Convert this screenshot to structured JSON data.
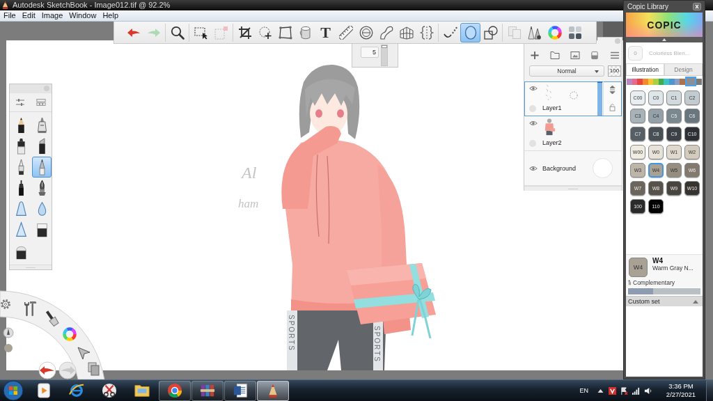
{
  "window": {
    "title": "Autodesk SketchBook - Image012.tif @ 92.2%"
  },
  "menu": [
    "File",
    "Edit",
    "Image",
    "Window",
    "Help"
  ],
  "toolbar": {
    "groups": [
      {
        "tools": [
          {
            "kind": "undo",
            "selected": false,
            "disabled": false
          },
          {
            "kind": "redo",
            "selected": false,
            "disabled": true
          }
        ]
      },
      {
        "tools": [
          {
            "kind": "zoom",
            "selected": false,
            "disabled": false
          }
        ]
      },
      {
        "tools": [
          {
            "kind": "select",
            "selected": false,
            "disabled": false
          },
          {
            "kind": "select-stamp",
            "selected": false,
            "disabled": true
          }
        ]
      },
      {
        "tools": [
          {
            "kind": "crop",
            "selected": false,
            "disabled": false
          },
          {
            "kind": "transform",
            "selected": false,
            "disabled": false
          },
          {
            "kind": "distort",
            "selected": false,
            "disabled": false
          },
          {
            "kind": "fill",
            "selected": false,
            "disabled": false
          },
          {
            "kind": "text",
            "label": "T",
            "selected": false,
            "disabled": false
          },
          {
            "kind": "ruler",
            "selected": false,
            "disabled": false
          },
          {
            "kind": "ellipse-guide",
            "selected": false,
            "disabled": false
          },
          {
            "kind": "french-curve",
            "selected": false,
            "disabled": false
          },
          {
            "kind": "perspective",
            "selected": false,
            "disabled": false
          },
          {
            "kind": "symmetry",
            "selected": false,
            "disabled": false
          }
        ]
      },
      {
        "tools": [
          {
            "kind": "steady-stroke",
            "selected": false,
            "disabled": false
          },
          {
            "kind": "ellipse",
            "selected": true,
            "disabled": false
          },
          {
            "kind": "shapes",
            "selected": false,
            "disabled": false
          }
        ]
      },
      {
        "tools": [
          {
            "kind": "copy",
            "selected": false,
            "disabled": true
          },
          {
            "kind": "brushes",
            "selected": false,
            "disabled": false
          },
          {
            "kind": "color-wheel",
            "selected": false,
            "disabled": false
          },
          {
            "kind": "swatches",
            "selected": false,
            "disabled": false
          }
        ]
      }
    ]
  },
  "brush_size": {
    "value": "5",
    "level": 1
  },
  "canvas": {
    "sketch_notes": [
      "Al",
      "ham"
    ],
    "pants_prints": [
      "SPORTS",
      "SPORTS"
    ]
  },
  "layers": {
    "blend_mode": "Normal",
    "opacity": "100",
    "items": [
      {
        "name": "Layer1",
        "kind": "sketch",
        "visible": true,
        "selected": true
      },
      {
        "name": "Layer2",
        "kind": "figure",
        "visible": true,
        "selected": false
      },
      {
        "name": "Background",
        "kind": "background",
        "visible": true,
        "selected": false
      }
    ]
  },
  "brush_palette": {
    "brushes": [
      {
        "kind": "pencil",
        "selected": false
      },
      {
        "kind": "airbrush",
        "selected": false
      },
      {
        "kind": "marker",
        "selected": false
      },
      {
        "kind": "chisel",
        "selected": false
      },
      {
        "kind": "pen",
        "selected": false
      },
      {
        "kind": "ballpoint",
        "selected": true
      },
      {
        "kind": "fineliner",
        "selected": false
      },
      {
        "kind": "nib",
        "selected": false
      },
      {
        "kind": "blur",
        "selected": false
      },
      {
        "kind": "drop",
        "selected": false
      },
      {
        "kind": "sharpen",
        "selected": false
      },
      {
        "kind": "eraser",
        "selected": false
      },
      {
        "kind": "soft-eraser",
        "selected": false
      }
    ]
  },
  "copic_library": {
    "title": "Copic Library",
    "logo": "COPIC",
    "blender": {
      "code": "0",
      "name": "Colorless Blen..."
    },
    "tabs": [
      {
        "label": "Illustration",
        "selected": true
      },
      {
        "label": "Design",
        "selected": false
      }
    ],
    "families": [
      {
        "color": "#b889c0",
        "selected": false
      },
      {
        "color": "#e46b8c",
        "selected": false
      },
      {
        "color": "#e8473f",
        "selected": false
      },
      {
        "color": "#f28a2d",
        "selected": false
      },
      {
        "color": "#f4c534",
        "selected": false
      },
      {
        "color": "#a8cf45",
        "selected": false
      },
      {
        "color": "#3fae49",
        "selected": false
      },
      {
        "color": "#3ec3c7",
        "selected": false
      },
      {
        "color": "#4d96d3",
        "selected": false
      },
      {
        "color": "#8e9cc2",
        "selected": false
      },
      {
        "color": "#a9744f",
        "selected": false
      },
      {
        "color": "#8a9099",
        "selected": true
      },
      {
        "color": "#7a7a7a",
        "selected": false
      }
    ],
    "swatches": [
      {
        "code": "C00",
        "color": "#e9eef0",
        "selected": false
      },
      {
        "code": "C0",
        "color": "#dfe6e9",
        "selected": false
      },
      {
        "code": "C1",
        "color": "#d2dadd",
        "selected": false
      },
      {
        "code": "C2",
        "color": "#c2cbd0",
        "selected": false
      },
      {
        "code": "C3",
        "color": "#a8b3b9",
        "selected": false
      },
      {
        "code": "C4",
        "color": "#95a1a8",
        "selected": false
      },
      {
        "code": "C5",
        "color": "#7c8890",
        "selected": false
      },
      {
        "code": "C6",
        "color": "#6a767e",
        "selected": false
      },
      {
        "code": "C7",
        "color": "#565f66",
        "selected": false
      },
      {
        "code": "C8",
        "color": "#484f55",
        "selected": false
      },
      {
        "code": "C9",
        "color": "#3b4146",
        "selected": false
      },
      {
        "code": "C10",
        "color": "#2c3034",
        "selected": false
      },
      {
        "code": "W00",
        "color": "#f0ece2",
        "selected": false
      },
      {
        "code": "W0",
        "color": "#e8e3d8",
        "selected": false
      },
      {
        "code": "W1",
        "color": "#e0dace",
        "selected": false
      },
      {
        "code": "W2",
        "color": "#d2cbbe",
        "selected": false
      },
      {
        "code": "W3",
        "color": "#bdb5a8",
        "selected": false
      },
      {
        "code": "W4",
        "color": "#a9a194",
        "selected": true
      },
      {
        "code": "W5",
        "color": "#958d80",
        "selected": false
      },
      {
        "code": "W6",
        "color": "#827a6e",
        "selected": false
      },
      {
        "code": "W7",
        "color": "#6b655b",
        "selected": false
      },
      {
        "code": "W8",
        "color": "#57524a",
        "selected": false
      },
      {
        "code": "W9",
        "color": "#48443e",
        "selected": false
      },
      {
        "code": "W10",
        "color": "#37342f",
        "selected": false
      },
      {
        "code": "100",
        "color": "#2a2a2a",
        "selected": false
      },
      {
        "code": "110",
        "color": "#000000",
        "selected": false
      }
    ],
    "current": {
      "swatch_code": "W4",
      "code": "W4",
      "name": "Warm Gray N...",
      "color": "#a9a194"
    },
    "complementary": "Complementary",
    "complementary_bar": {
      "level": 0.35
    },
    "custom_set": "Custom set"
  },
  "taskbar": {
    "apps": [
      {
        "kind": "play",
        "running": false,
        "active": false
      },
      {
        "kind": "ebrowser",
        "running": false,
        "active": false
      },
      {
        "kind": "scissors",
        "running": false,
        "active": false
      },
      {
        "kind": "folder",
        "running": false,
        "active": false
      },
      {
        "kind": "roundbrowser",
        "running": true,
        "active": false
      },
      {
        "kind": "books",
        "running": true,
        "active": false
      },
      {
        "kind": "document",
        "running": true,
        "active": false
      },
      {
        "kind": "pencil",
        "running": true,
        "active": true
      }
    ],
    "language": "EN",
    "time": "3:36 PM",
    "date": "2/27/2021"
  }
}
